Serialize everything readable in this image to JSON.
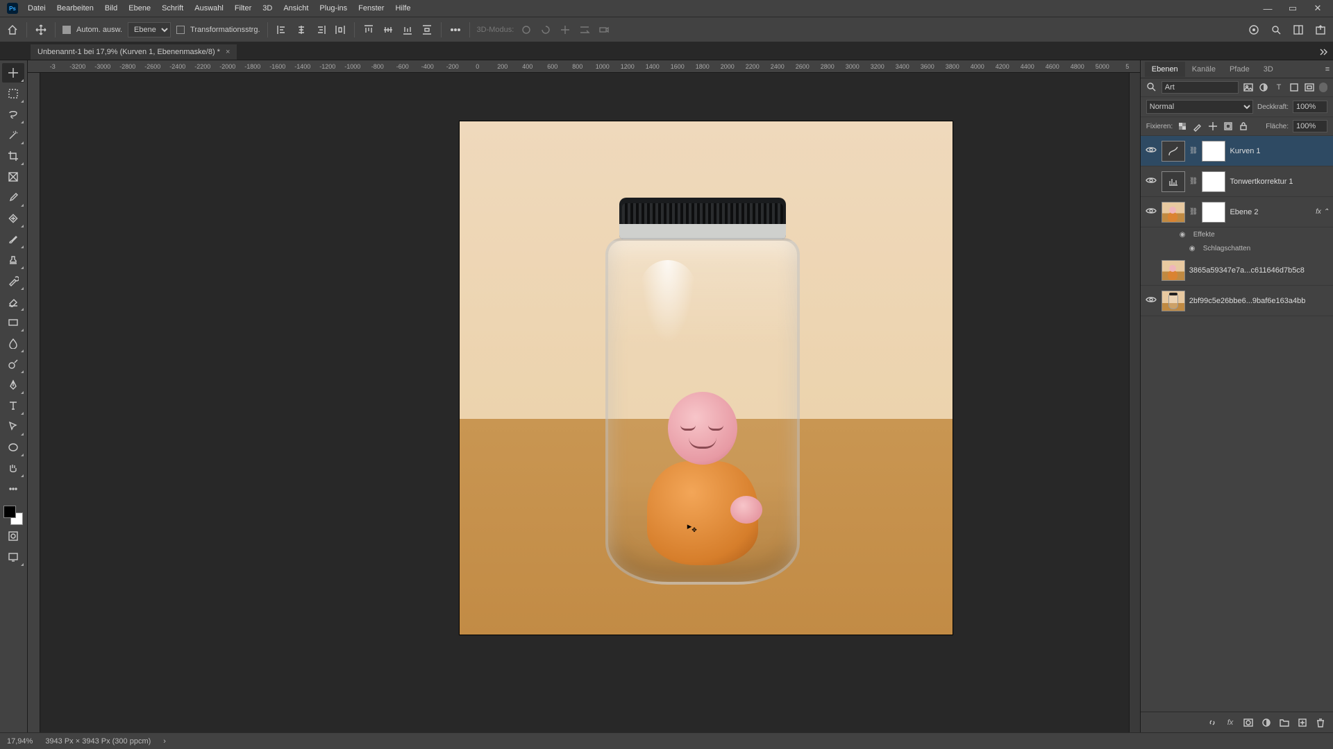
{
  "menu": {
    "items": [
      "Datei",
      "Bearbeiten",
      "Bild",
      "Ebene",
      "Schrift",
      "Auswahl",
      "Filter",
      "3D",
      "Ansicht",
      "Plug-ins",
      "Fenster",
      "Hilfe"
    ]
  },
  "win": {
    "min": "—",
    "max": "▭",
    "close": "✕"
  },
  "options": {
    "autoSelect": "Autom. ausw.",
    "targetValue": "Ebene",
    "transform": "Transformationsstrg.",
    "mode3d": "3D-Modus:"
  },
  "doc": {
    "tabTitle": "Unbenannt-1 bei 17,9% (Kurven 1, Ebenenmaske/8) *",
    "closeGlyph": "×"
  },
  "ruler": {
    "ticks": [
      "-3",
      "-3200",
      "-3000",
      "-2800",
      "-2600",
      "-2400",
      "-2200",
      "-2000",
      "-1800",
      "-1600",
      "-1400",
      "-1200",
      "-1000",
      "-800",
      "-600",
      "-400",
      "-200",
      "0",
      "200",
      "400",
      "600",
      "800",
      "1000",
      "1200",
      "1400",
      "1600",
      "1800",
      "2000",
      "2200",
      "2400",
      "2600",
      "2800",
      "3000",
      "3200",
      "3400",
      "3600",
      "3800",
      "4000",
      "4200",
      "4400",
      "4600",
      "4800",
      "5000",
      "5"
    ]
  },
  "panels": {
    "tabs": {
      "ebenen": "Ebenen",
      "kanaele": "Kanäle",
      "pfade": "Pfade",
      "d3": "3D"
    },
    "filter": {
      "placeholder": "Art"
    },
    "blend": {
      "mode": "Normal",
      "opacityLabel": "Deckkraft:",
      "opacityValue": "100%",
      "lockLabel": "Fixieren:",
      "fillLabel": "Fläche:",
      "fillValue": "100%"
    },
    "layers": [
      {
        "name": "Kurven 1",
        "adjIcon": "curves",
        "mask": true,
        "visible": true,
        "selected": true
      },
      {
        "name": "Tonwertkorrektur 1",
        "adjIcon": "levels",
        "mask": true,
        "visible": true
      },
      {
        "name": "Ebene 2",
        "mask": true,
        "visible": true,
        "fx": true,
        "thumbKind": "monk"
      },
      {
        "name": "3865a59347e7a...c611646d7b5c8",
        "visible": false,
        "thumbKind": "monk"
      },
      {
        "name": "2bf99c5e26bbe6...9baf6e163a4bb",
        "visible": true,
        "thumbKind": "jar"
      }
    ],
    "fx": {
      "effects": "Effekte",
      "dropshadow": "Schlagschatten"
    }
  },
  "status": {
    "zoom": "17,94%",
    "info": "3943 Px × 3943 Px (300 ppcm)",
    "chevron": "›"
  }
}
